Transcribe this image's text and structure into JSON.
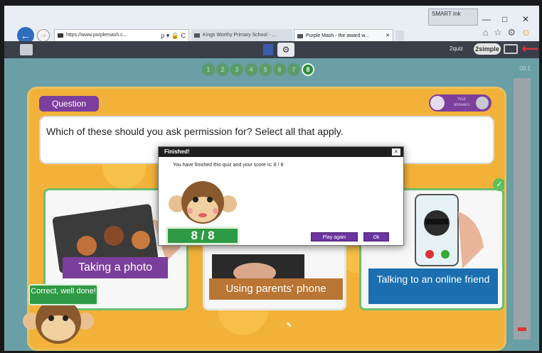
{
  "browser": {
    "smart_ink": "SMART Ink",
    "minimize": "—",
    "restore": "□",
    "close": "✕",
    "back": "←",
    "forward": "→",
    "address": "https://www.purplemash.c...",
    "address_tools": "ρ ▾ 🔒 C",
    "tabs": [
      {
        "label": "Kings Worthy Primary School - ..."
      },
      {
        "label": "Purple Mash - the award w...",
        "close": "✕"
      }
    ],
    "right_icons": "⌂ ☆ ⚙"
  },
  "appbar": {
    "quiz_label": "2quiz",
    "simple_label": "2simple",
    "exit_icon": "exit-arrow-icon"
  },
  "quiz": {
    "steps": [
      "1",
      "2",
      "3",
      "4",
      "5",
      "6",
      "7",
      "8"
    ],
    "current_step": "8",
    "timer": "00:1",
    "question_label": "Question",
    "answers_toggle": "Your answers",
    "question": "Which of these should you ask permission for? Select all that apply.",
    "answers": [
      {
        "label": "Taking a photo"
      },
      {
        "label": "Using parents' phone"
      },
      {
        "label": "Talking to an online friend"
      }
    ]
  },
  "dialog": {
    "title": "Finished!",
    "close": "×",
    "message": "You have finished this quiz and your score is: 8 / 8",
    "score": "8 / 8",
    "play_again": "Play again",
    "ok": "Ok"
  },
  "feedback": {
    "correct": "Correct, well done!"
  },
  "colors": {
    "purple": "#7c3f9c",
    "orange_panel": "#f2b23a",
    "green": "#2f9a45",
    "blue_label": "#1b6fb0"
  }
}
